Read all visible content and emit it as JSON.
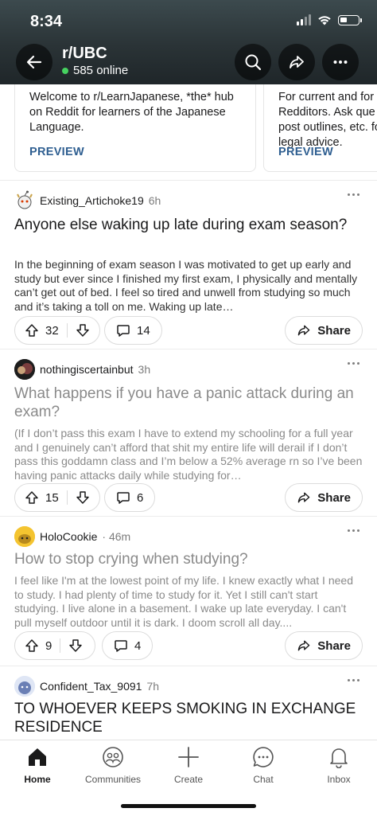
{
  "status_bar": {
    "time": "8:34"
  },
  "header": {
    "subreddit": "r/UBC",
    "online": "585 online"
  },
  "cards": [
    {
      "text": "Welcome to r/LearnJapanese, *the* hub on Reddit for learners of the Japanese Language.",
      "action": "PREVIEW"
    },
    {
      "text": "For current and for Redditors. Ask que post outlines, etc. for legal advice.",
      "action": "PREVIEW"
    }
  ],
  "posts": [
    {
      "author": "Existing_Artichoke19",
      "time": "6h",
      "title": "Anyone else waking up late during exam season?",
      "body": "In the beginning of exam season I was motivated to get up early and study but ever since I finished my first exam, I physically and mentally can’t get out of bed. I feel so tired and unwell from studying so much and it’s taking a toll on me. Waking up late…",
      "votes": "32",
      "comments": "14",
      "share": "Share"
    },
    {
      "author": "nothingiscertainbut",
      "time": "3h",
      "title": "What happens if you have a panic attack during an exam?",
      "body": "(If I don’t pass this exam I have to extend my schooling for a full year and I genuinely can’t afford that shit my entire life will derail if I don’t pass this goddamn class and I’m below a 52% average rn so I’ve been having panic attacks daily while studying for…",
      "votes": "15",
      "comments": "6",
      "share": "Share"
    },
    {
      "author": "HoloCookie",
      "time": "46m",
      "title": "How to stop crying when studying?",
      "body": "I feel like I'm at the lowest point of my life. I knew exactly what I need to study. I had plenty of time to study for it. Yet I still can't start studying. I live alone in a basement. I wake up late everyday. I can't pull myself outdoor until it is dark. I doom scroll all day....",
      "votes": "9",
      "comments": "4",
      "share": "Share"
    },
    {
      "author": "Confident_Tax_9091",
      "time": "7h",
      "title": "TO WHOEVER KEEPS SMOKING IN EXCHANGE RESIDENCE"
    }
  ],
  "tabbar": {
    "items": [
      {
        "label": "Home",
        "icon": "home-icon"
      },
      {
        "label": "Communities",
        "icon": "communities-icon"
      },
      {
        "label": "Create",
        "icon": "plus-icon"
      },
      {
        "label": "Chat",
        "icon": "chat-icon"
      },
      {
        "label": "Inbox",
        "icon": "bell-icon"
      }
    ]
  },
  "colors": {
    "online_dot": "#46d160",
    "preview_link": "#2f5f91",
    "header_bg": "#2a3336"
  }
}
